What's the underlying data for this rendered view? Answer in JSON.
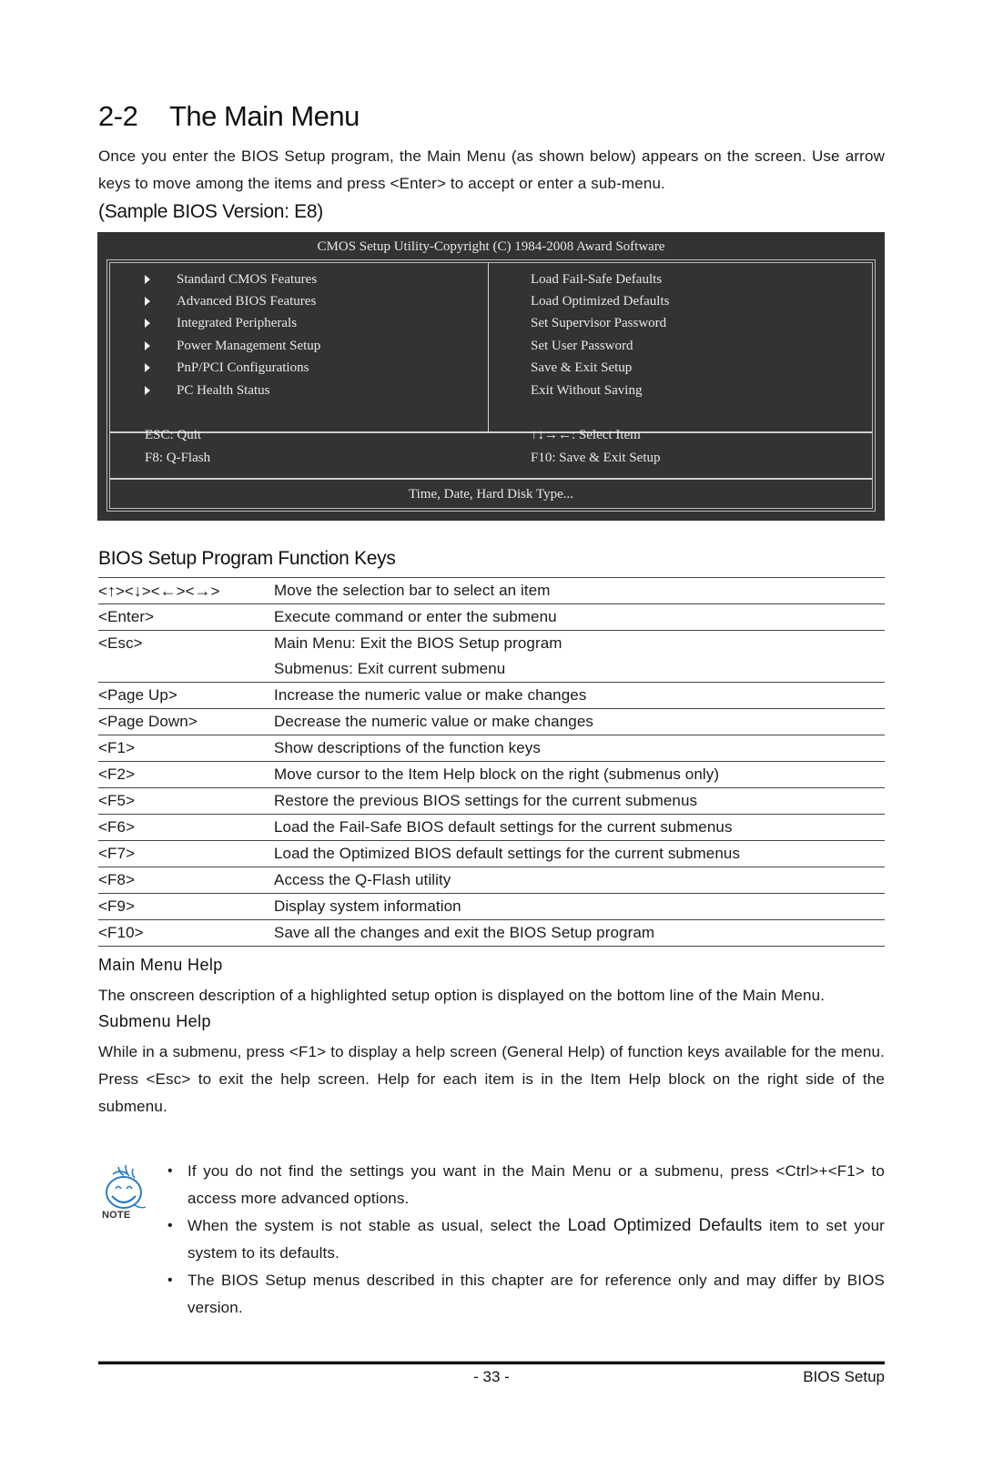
{
  "section": {
    "number": "2-2",
    "title": "The Main Menu",
    "intro": "Once you enter the BIOS Setup program, the Main Menu (as shown below) appears on the screen. Use arrow keys to move among the items and press <Enter> to accept or enter a sub-menu.",
    "sample_label": "(Sample BIOS Version: E8)"
  },
  "bios_screen": {
    "header": "CMOS Setup Utility-Copyright (C) 1984-2008 Award Software",
    "left_items": [
      "Standard CMOS Features",
      "Advanced BIOS Features",
      "Integrated Peripherals",
      "Power Management Setup",
      "PnP/PCI Configurations",
      "PC Health Status"
    ],
    "right_items": [
      "Load Fail-Safe Defaults",
      "Load Optimized Defaults",
      "Set Supervisor Password",
      "Set User Password",
      "Save & Exit Setup",
      "Exit Without Saving"
    ],
    "hints_left": [
      "ESC: Quit",
      "F8: Q-Flash"
    ],
    "hints_right": [
      "↑↓→←: Select Item",
      "F10: Save & Exit Setup"
    ],
    "status_line": "Time, Date, Hard Disk Type..."
  },
  "function_keys": {
    "heading": "BIOS Setup Program Function Keys",
    "arrow_key_parts": [
      "<",
      "↑",
      "><",
      "↓",
      "><",
      "←",
      "><",
      "→",
      ">"
    ],
    "rows": [
      {
        "key": "<↑><↓><←><→>",
        "desc": [
          "Move the selection bar to select an item"
        ]
      },
      {
        "key": "<Enter>",
        "desc": [
          "Execute command or enter the submenu"
        ]
      },
      {
        "key": "<Esc>",
        "desc": [
          "Main Menu: Exit the BIOS Setup program",
          "Submenus: Exit current submenu"
        ]
      },
      {
        "key": "<Page Up>",
        "desc": [
          "Increase the numeric value or make changes"
        ]
      },
      {
        "key": "<Page Down>",
        "desc": [
          "Decrease the numeric value or make changes"
        ]
      },
      {
        "key": "<F1>",
        "desc": [
          "Show descriptions of the function keys"
        ]
      },
      {
        "key": "<F2>",
        "desc": [
          "Move cursor to the Item Help block on the right (submenus only)"
        ]
      },
      {
        "key": "<F5>",
        "desc": [
          "Restore the previous BIOS settings for the current submenus"
        ]
      },
      {
        "key": "<F6>",
        "desc": [
          "Load the Fail-Safe BIOS default settings for the current submenus"
        ]
      },
      {
        "key": "<F7>",
        "desc": [
          "Load the Optimized BIOS default settings for the current submenus"
        ]
      },
      {
        "key": "<F8>",
        "desc": [
          "Access the Q-Flash utility"
        ]
      },
      {
        "key": "<F9>",
        "desc": [
          "Display system information"
        ]
      },
      {
        "key": "<F10>",
        "desc": [
          "Save all the changes and exit the BIOS Setup program"
        ]
      }
    ]
  },
  "main_menu_help": {
    "heading": "Main Menu Help",
    "text": "The onscreen description of a highlighted setup option is displayed on the bottom line of the Main Menu."
  },
  "submenu_help": {
    "heading": "Submenu Help",
    "text": "While in a submenu, press <F1> to display a help screen (General Help) of function keys available for the menu. Press <Esc> to exit the help screen. Help for each item is in the Item Help block on the right side of the submenu."
  },
  "note": {
    "icon": "smiley-note-icon",
    "label": "NOTE",
    "bullets": [
      {
        "text": "If you do not find the settings you want in the Main Menu or a submenu, press <Ctrl>+<F1> to access more advanced options."
      },
      {
        "before": "When the system is not stable as usual, select the ",
        "highlight": "Load Optimized Defaults",
        "after": " item to set your system to its defaults."
      },
      {
        "text": "The BIOS Setup menus described in this chapter are for reference only and may differ by BIOS version."
      }
    ],
    "bullet_glyph": "•"
  },
  "footer": {
    "page_number": "- 33 -",
    "section_name": "BIOS Setup"
  },
  "colors": {
    "bios_background": "#333333",
    "bios_text": "#e8e8e8",
    "note_icon": "#2a7bc4"
  }
}
